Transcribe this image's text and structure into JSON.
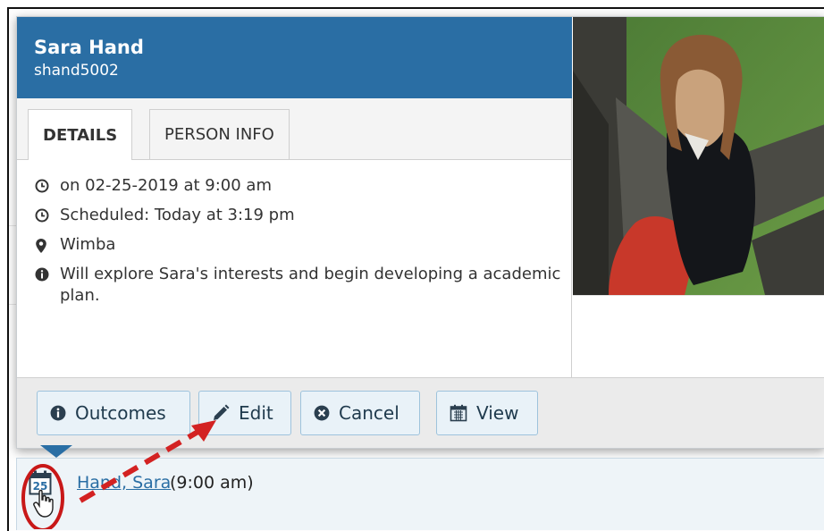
{
  "person": {
    "name": "Sara Hand",
    "username": "shand5002"
  },
  "tabs": [
    {
      "label": "DETAILS",
      "active": true
    },
    {
      "label": "PERSON INFO",
      "active": false
    }
  ],
  "details": {
    "date_line": "on 02-25-2019 at 9:00 am",
    "scheduled_line": "Scheduled: Today at 3:19 pm",
    "location": "Wimba",
    "note": "Will explore Sara's interests and begin developing a academic plan."
  },
  "buttons": {
    "outcomes": "Outcomes",
    "edit": "Edit",
    "cancel": "Cancel",
    "view": "View"
  },
  "event": {
    "name_link": "Hand, Sara",
    "time": "(9:00 am)",
    "calendar_day": "25"
  },
  "colors": {
    "header": "#2a6ea4",
    "button_bg": "#e9f2f8",
    "button_border": "#9ec3dc",
    "annotation": "#d32222",
    "link": "#2a6ea4"
  },
  "icons": {
    "date": "clock-icon",
    "scheduled": "clock-icon",
    "location": "map-marker-icon",
    "note": "info-icon",
    "outcomes": "info-icon",
    "edit": "pencil-icon",
    "cancel": "times-circle-icon",
    "view": "calendar-icon"
  }
}
